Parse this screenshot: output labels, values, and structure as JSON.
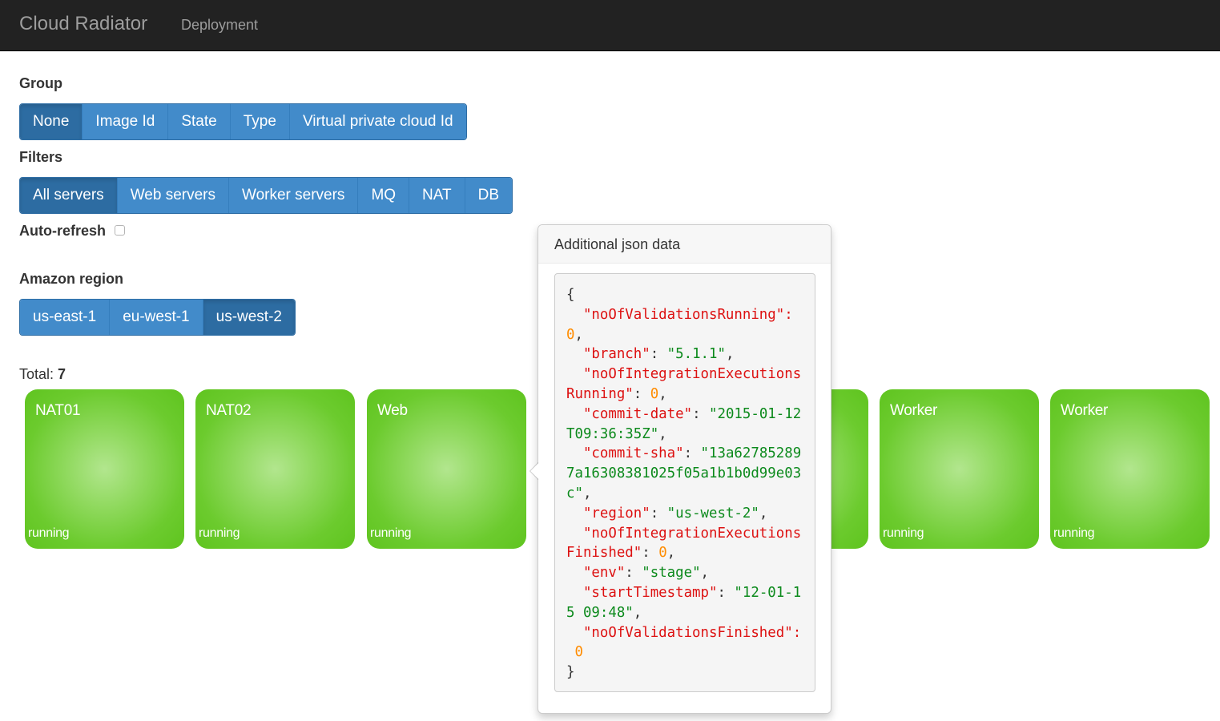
{
  "navbar": {
    "brand": "Cloud Radiator",
    "links": [
      "Deployment"
    ]
  },
  "group": {
    "label": "Group",
    "options": [
      "None",
      "Image Id",
      "State",
      "Type",
      "Virtual private cloud Id"
    ],
    "active": "None"
  },
  "filters": {
    "label": "Filters",
    "options": [
      "All servers",
      "Web servers",
      "Worker servers",
      "MQ",
      "NAT",
      "DB"
    ],
    "active": "All servers"
  },
  "auto_refresh": {
    "label": "Auto-refresh",
    "checked": false
  },
  "region": {
    "label": "Amazon region",
    "options": [
      "us-east-1",
      "eu-west-1",
      "us-west-2"
    ],
    "active": "us-west-2"
  },
  "total": {
    "label": "Total:",
    "count": "7"
  },
  "tiles": [
    {
      "name": "NAT01",
      "state": "running"
    },
    {
      "name": "NAT02",
      "state": "running"
    },
    {
      "name": "Web",
      "state": "running"
    },
    {
      "name": "",
      "state": ""
    },
    {
      "name": "",
      "state": ""
    },
    {
      "name": "Worker",
      "state": "running"
    },
    {
      "name": "Worker",
      "state": "running"
    }
  ],
  "tile_color": "#6ccb2e",
  "popover": {
    "title": "Additional json data",
    "json_lines": [
      [
        [
          "{",
          "p"
        ]
      ],
      [
        [
          "  \"noOfValidationsRunning\":",
          "k"
        ]
      ],
      [
        [
          "0",
          "n"
        ],
        [
          ",",
          "p"
        ]
      ],
      [
        [
          "  \"branch\"",
          "k"
        ],
        [
          ": ",
          "p"
        ],
        [
          "\"5.1.1\"",
          "s"
        ],
        [
          ",",
          "p"
        ]
      ],
      [
        [
          "  \"noOfIntegrationExecutions",
          "k"
        ]
      ],
      [
        [
          "Running\"",
          "k"
        ],
        [
          ": ",
          "p"
        ],
        [
          "0",
          "n"
        ],
        [
          ",",
          "p"
        ]
      ],
      [
        [
          "  \"commit-date\"",
          "k"
        ],
        [
          ": ",
          "p"
        ],
        [
          "\"2015-01-12",
          "s"
        ]
      ],
      [
        [
          "T09:36:35Z\"",
          "s"
        ],
        [
          ",",
          "p"
        ]
      ],
      [
        [
          "  \"commit-sha\"",
          "k"
        ],
        [
          ": ",
          "p"
        ],
        [
          "\"13a62785289",
          "s"
        ]
      ],
      [
        [
          "7a16308381025f05a1b1b0d99e03",
          "s"
        ]
      ],
      [
        [
          "c\"",
          "s"
        ],
        [
          ",",
          "p"
        ]
      ],
      [
        [
          "  \"region\"",
          "k"
        ],
        [
          ": ",
          "p"
        ],
        [
          "\"us-west-2\"",
          "s"
        ],
        [
          ",",
          "p"
        ]
      ],
      [
        [
          "  \"noOfIntegrationExecutions",
          "k"
        ]
      ],
      [
        [
          "Finished\"",
          "k"
        ],
        [
          ": ",
          "p"
        ],
        [
          "0",
          "n"
        ],
        [
          ",",
          "p"
        ]
      ],
      [
        [
          "  \"env\"",
          "k"
        ],
        [
          ": ",
          "p"
        ],
        [
          "\"stage\"",
          "s"
        ],
        [
          ",",
          "p"
        ]
      ],
      [
        [
          "  \"startTimestamp\"",
          "k"
        ],
        [
          ": ",
          "p"
        ],
        [
          "\"12-01-1",
          "s"
        ]
      ],
      [
        [
          "5 09:48\"",
          "s"
        ],
        [
          ",",
          "p"
        ]
      ],
      [
        [
          "  \"noOfValidationsFinished\":",
          "k"
        ]
      ],
      [
        [
          " ",
          "p"
        ],
        [
          "0",
          "n"
        ]
      ],
      [
        [
          "}",
          "p"
        ]
      ]
    ]
  }
}
